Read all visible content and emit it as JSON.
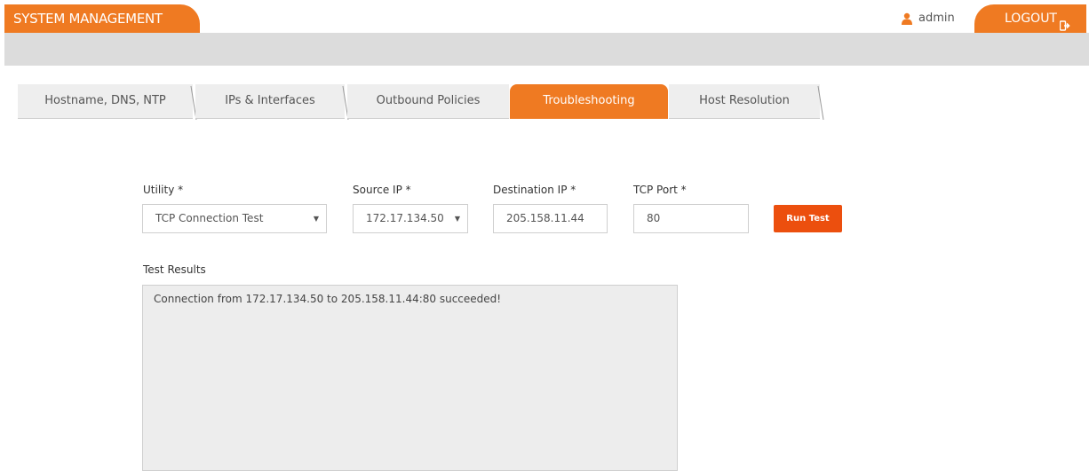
{
  "header": {
    "title": "SYSTEM MANAGEMENT",
    "user_icon": "user-icon",
    "username": "admin",
    "logout_label": "LOGOUT",
    "logout_icon": "logout-icon",
    "accent_color": "#ef7a22"
  },
  "tabs": [
    {
      "label": "Hostname, DNS, NTP",
      "active": false
    },
    {
      "label": "IPs & Interfaces",
      "active": false
    },
    {
      "label": "Outbound Policies",
      "active": false
    },
    {
      "label": "Troubleshooting",
      "active": true
    },
    {
      "label": "Host Resolution",
      "active": false
    }
  ],
  "form": {
    "utility": {
      "label": "Utility *",
      "value": "TCP Connection Test"
    },
    "source_ip": {
      "label": "Source IP *",
      "value": "172.17.134.50"
    },
    "destination_ip": {
      "label": "Destination IP *",
      "value": "205.158.11.44"
    },
    "tcp_port": {
      "label": "TCP Port *",
      "value": "80"
    },
    "run_button": "Run Test",
    "run_button_color": "#ec4f0e"
  },
  "results": {
    "label": "Test Results",
    "text": "Connection from 172.17.134.50 to 205.158.11.44:80 succeeded!"
  }
}
